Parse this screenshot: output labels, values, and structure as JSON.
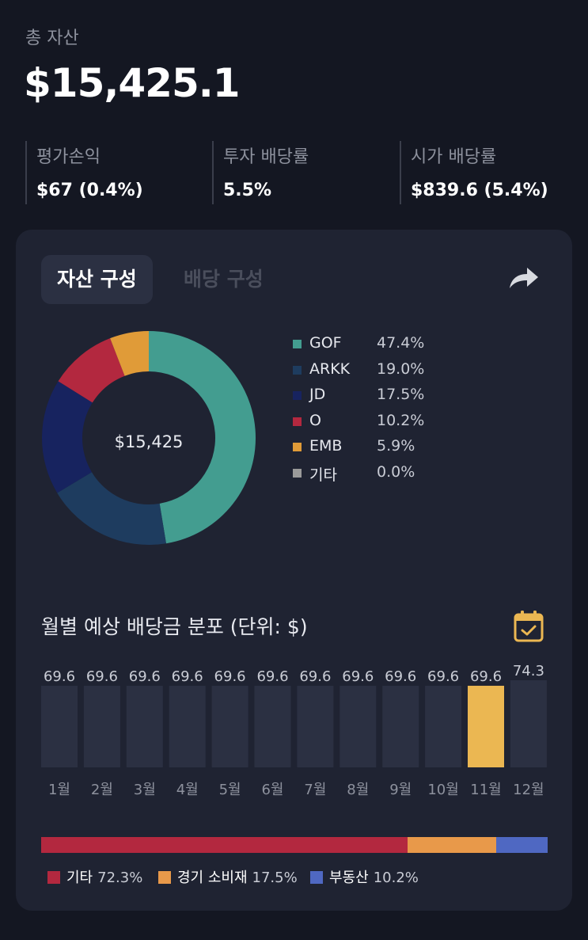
{
  "summary": {
    "total_label": "총 자산",
    "total_value": "$15,425.1",
    "stats": [
      {
        "label": "평가손익",
        "value": "$67 (0.4%)"
      },
      {
        "label": "투자 배당률",
        "value": "5.5%"
      },
      {
        "label": "시가 배당률",
        "value": "$839.6 (5.4%)"
      }
    ]
  },
  "tabs": [
    {
      "label": "자산 구성",
      "active": true
    },
    {
      "label": "배당 구성",
      "active": false
    }
  ],
  "share_icon": "share-arrow-icon",
  "allocation": {
    "center_label": "$15,425",
    "items": [
      {
        "name": "GOF",
        "pct_label": "47.4%",
        "value": 47.4,
        "color": "#439d90"
      },
      {
        "name": "ARKK",
        "pct_label": "19.0%",
        "value": 19.0,
        "color": "#1e3c5f"
      },
      {
        "name": "JD",
        "pct_label": "17.5%",
        "value": 17.5,
        "color": "#17235f"
      },
      {
        "name": "O",
        "pct_label": "10.2%",
        "value": 10.2,
        "color": "#b3283f"
      },
      {
        "name": "EMB",
        "pct_label": "5.9%",
        "value": 5.9,
        "color": "#e09b38"
      },
      {
        "name": "기타",
        "pct_label": "0.0%",
        "value": 0.0,
        "color": "#9a9a9a"
      }
    ]
  },
  "monthly": {
    "title": "월별 예상 배당금 분포 (단위: $)",
    "calendar_icon": "calendar-check-icon",
    "highlight_color": "#ebb752",
    "bar_color": "#2b3042"
  },
  "chart_data": {
    "type": "bar",
    "categories": [
      "1월",
      "2월",
      "3월",
      "4월",
      "5월",
      "6월",
      "7월",
      "8월",
      "9월",
      "10월",
      "11월",
      "12월"
    ],
    "values": [
      69.6,
      69.6,
      69.6,
      69.6,
      69.6,
      69.6,
      69.6,
      69.6,
      69.6,
      69.6,
      69.6,
      74.3
    ],
    "highlight_index": 10
  },
  "sectors": [
    {
      "name": "기타",
      "pct_label": "72.3%",
      "value": 72.3,
      "color": "#b3283f"
    },
    {
      "name": "경기 소비재",
      "pct_label": "17.5%",
      "value": 17.5,
      "color": "#e8994a"
    },
    {
      "name": "부동산",
      "pct_label": "10.2%",
      "value": 10.2,
      "color": "#4f68c2"
    }
  ]
}
